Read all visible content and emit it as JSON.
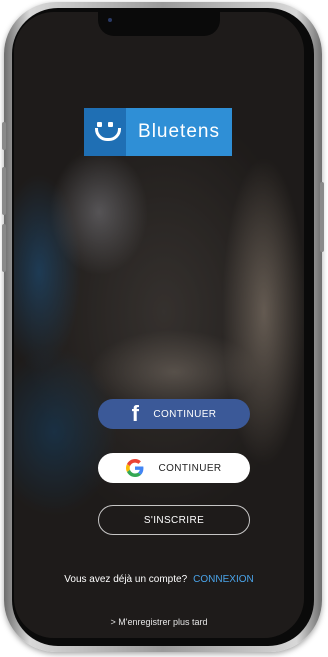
{
  "logo": {
    "text": "Bluetens"
  },
  "buttons": {
    "facebook_label": "CONTINUER",
    "google_label": "CONTINUER",
    "register_label": "S'INSCRIRE"
  },
  "account": {
    "prompt": "Vous avez déjà un compte?",
    "login_link": "CONNEXION"
  },
  "skip": {
    "label": "> M'enregistrer plus tard"
  },
  "colors": {
    "facebook": "#3b5998",
    "brand_blue": "#2f8fd6",
    "link_blue": "#4aa3e8"
  },
  "icons": [
    "facebook-icon",
    "google-icon",
    "smiley-logo-icon"
  ]
}
